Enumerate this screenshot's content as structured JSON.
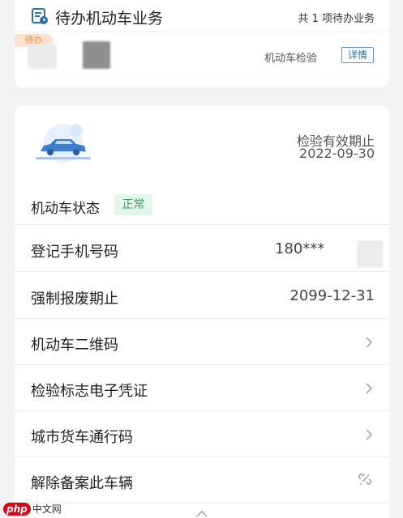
{
  "todo": {
    "title": "待办机动车业务",
    "count_text": "共 1 项待办业务",
    "pending_tag": "待办",
    "business_type": "机动车检验",
    "detail_label": "详情"
  },
  "vehicle": {
    "inspection_label": "检验有效期止",
    "inspection_date": "2022-09-30",
    "status_label": "机动车状态",
    "status_value": "正常",
    "status_color": "#2daa61"
  },
  "rows": [
    {
      "label": "登记手机号码",
      "value": "180***"
    },
    {
      "label": "强制报废期止",
      "value": "2099-12-31"
    },
    {
      "label": "机动车二维码",
      "icon": "chevron-right-icon"
    },
    {
      "label": "检验标志电子凭证",
      "icon": "chevron-right-icon"
    },
    {
      "label": "城市货车通行码",
      "icon": "chevron-right-icon"
    },
    {
      "label": "解除备案此车辆",
      "icon": "unlink-icon"
    }
  ],
  "watermark": {
    "brand": "php",
    "text": "中文网"
  },
  "colors": {
    "accent": "#2d6ea6",
    "pending": "#ec8c4a",
    "success": "#2daa61"
  }
}
